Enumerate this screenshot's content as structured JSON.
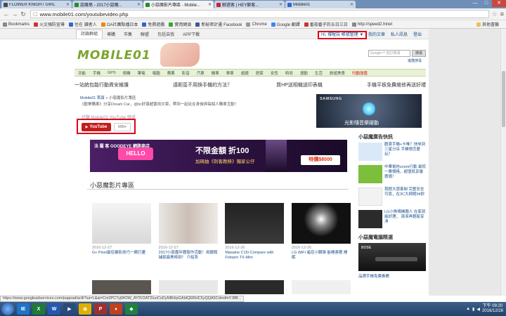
{
  "browser": {
    "tabs": [
      {
        "title": "FLOWER KNIGHT GIRL",
        "active": false,
        "color": "#4a4a4a"
      },
      {
        "title": "惡魔島 - 2017小惡魔...",
        "active": false,
        "color": "#2a8a2a"
      },
      {
        "title": "小惡魔影片專區 - Mobile...",
        "active": true,
        "color": "#2a8a2a"
      },
      {
        "title": "聊遊客 | HEY聊客...",
        "active": false,
        "color": "#cc2233"
      },
      {
        "title": "Mobile01",
        "active": false,
        "color": "#3366cc"
      }
    ],
    "window_buttons": [
      "—",
      "□",
      "✕"
    ],
    "address": "www.mobile01.com/youtubevideo.php",
    "bookmarks": [
      {
        "label": "Bookmarks",
        "color": "#888"
      },
      {
        "label": "火災預防宣導",
        "color": "#cc3333"
      },
      {
        "label": "住在 讀者人",
        "color": "#3366cc"
      },
      {
        "label": "OA社團點播日本",
        "color": "#ee8800"
      },
      {
        "label": "免費遊戲",
        "color": "#3366cc"
      },
      {
        "label": "實用網頁",
        "color": "#33aa33"
      },
      {
        "label": "新秘密計畫 Facebook",
        "color": "#3b5998"
      },
      {
        "label": "Chrome",
        "color": "#999"
      },
      {
        "label": "Google 翻譯",
        "color": "#4285f4"
      },
      {
        "label": "番茄番子的五日三日",
        "color": "#cc3333"
      },
      {
        "label": "http://speed2.hinet",
        "color": "#888"
      }
    ],
    "other_bookmarks": "其他書籤"
  },
  "site": {
    "top_tabs": [
      "討論群組",
      "導購",
      "市集",
      "聯盟",
      "包括自我",
      "APP下載"
    ],
    "user_menu": "Hi, 撐喔玩 帳號管理 ▼",
    "top_right": [
      "我的文章",
      "私人訊息",
      "登出"
    ],
    "logo": "MOBILE01",
    "search_placeholder": "Google™ 自訂搜尋",
    "search_button": "搜尋",
    "advanced_search": "進階搜尋",
    "categories": [
      "功能",
      "手機",
      "GPS",
      "相機",
      "筆電",
      "電腦",
      "蘋果",
      "影音",
      "汽車",
      "機車",
      "單車",
      "遊戲",
      "居家",
      "女性",
      "時尚",
      "運動",
      "生活",
      "旅遊美食",
      "行動加值"
    ],
    "promo_links": [
      "一站統包能行動資安維護",
      "遠距區不用換手機的方法？",
      "買HP送相機送印表機",
      "手機平板免費維修再送好禮"
    ],
    "breadcrumb_home": "Mobile01 首頁",
    "breadcrumb_current": "小惡魔影片專區",
    "intro": "《歡樂購車》分享Dream Car，@bc好康超實用文章，帶到一起玩在身後與每個人購車互動！",
    "stray_text": "好聽 Mobile01 YouTube 頻道",
    "youtube_label": "YouTube",
    "youtube_count": "999+",
    "samsung_brand": "SAMSUNG",
    "samsung_caption": "光影隨音樂躍動",
    "banner": {
      "left_text": "法 羅 客 GOODEYE 網路商店",
      "hello": "HELLO",
      "headline": "不限金額 折100",
      "sub": "加碼抽《刺客教條》獨家公仔",
      "price": "特價$8000"
    },
    "section_title": "小惡魔影片專區",
    "videos": [
      {
        "date": "2016-12-27",
        "title": "G+ Pixel最佳攝影技巧一網打盡"
      },
      {
        "date": "2016-12-27",
        "title": "2017小惡魔年曆製作活動！用鏡頭捕捉最美時刻！ 介紹系"
      },
      {
        "date": "2016-12-26",
        "title": "Masaine C15i Compare with Fotopro TX-Mini"
      },
      {
        "date": "2016-12-26",
        "title": "LG WiFi 遙控小鋼彈 能睡連著 睡眠"
      }
    ],
    "sidebar": {
      "heading": "小惡魔廣告快訊",
      "items": [
        {
          "text": "觀賞手機+卡唯？快來到三星分店 手機想怎麼玩？",
          "color": "#d9e9f7"
        },
        {
          "text": "中華電信zoom行動 最低一費價格，超值抵享優惠價！",
          "color": "#7cbf3a"
        },
        {
          "text": "我輕大感客制 完整安全可靠，在3C大師館94鈔",
          "color": "#f2f2f2"
        },
        {
          "text": "LG小魚嘴機器人 在家就能好理， 清潔再輕鬆享淨",
          "color": "#2b2b2b"
        }
      ],
      "heading2": "小惡魔電腦精選",
      "bottom_brand": "BOSE",
      "bottom_caption": "品牌手帳免費推薦"
    }
  },
  "status_url": "https://www.googleadservices.com/pagead/aclk?sa=L&ai=Cm3PC7yjWOW_AY3V2AT2IuoCoDyNBHipGAIdQEBHC5yQQA5CdmdlnYJ8B...",
  "taskbar": {
    "apps": [
      {
        "label": "IE",
        "color": "#1e73c7"
      },
      {
        "label": "X",
        "color": "#1f7a35"
      },
      {
        "label": "W",
        "color": "#2657b0"
      },
      {
        "label": "▶",
        "color": "#2a4a7a"
      },
      {
        "label": "◉",
        "color": "#e0b000"
      },
      {
        "label": "P",
        "color": "#a03030"
      },
      {
        "label": "♦",
        "color": "#c04020"
      },
      {
        "label": "◆",
        "color": "#208040"
      }
    ],
    "time": "下午 09:20",
    "date": "2016/12/28"
  }
}
